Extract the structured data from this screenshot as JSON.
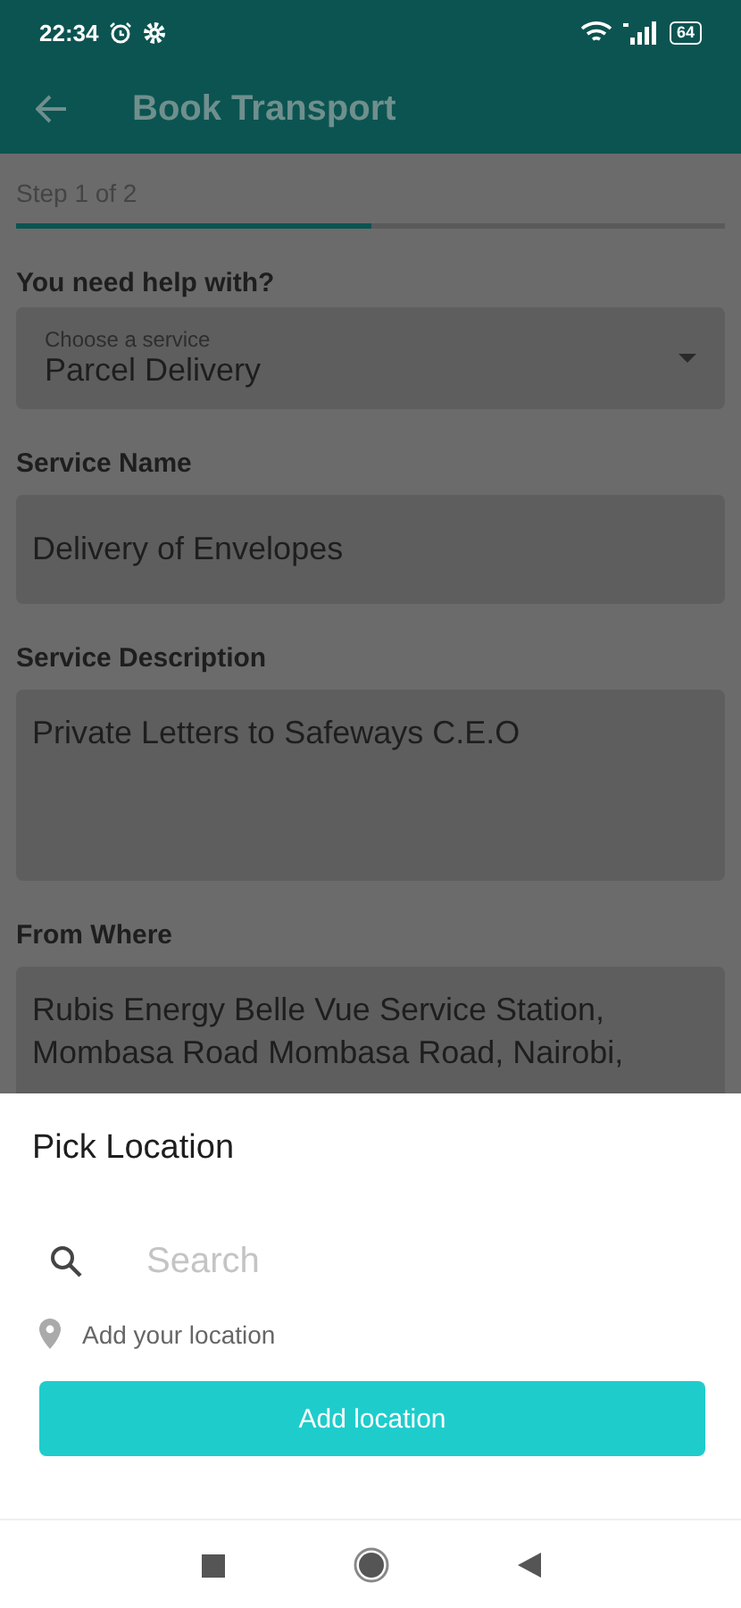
{
  "status_bar": {
    "time": "22:34",
    "battery": "64"
  },
  "app_bar": {
    "title": "Book Transport"
  },
  "step": {
    "label": "Step 1 of 2",
    "level": 0.5
  },
  "form": [
    {
      "kind": "dropdown",
      "label": "You need help with?",
      "hint": "Choose a service",
      "value": "Parcel Delivery"
    },
    {
      "kind": "text",
      "label": "Service Name",
      "value": "Delivery of Envelopes"
    },
    {
      "kind": "multiline",
      "label": "Service Description",
      "value": "Private Letters to Safeways C.E.O"
    },
    {
      "kind": "multiline",
      "label": "From Where",
      "value": "Rubis Energy Belle Vue Service Station, Mombasa Road Mombasa Road, Nairobi,"
    }
  ],
  "sheet": {
    "title": "Pick Location",
    "search": {
      "placeholder": "Search"
    },
    "location_hint": "Add your location",
    "button": "Add location"
  }
}
